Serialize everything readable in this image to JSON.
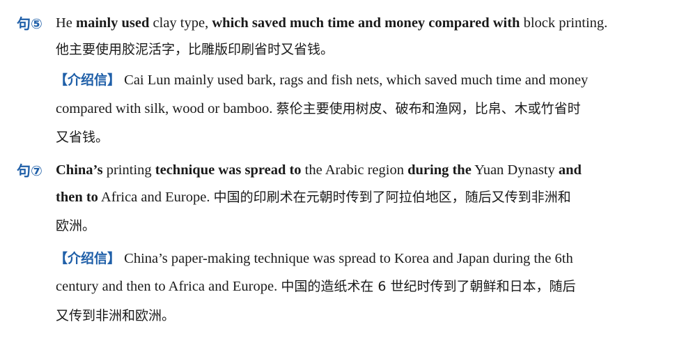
{
  "entries": [
    {
      "num": "句⑤",
      "main": {
        "line1": {
          "p1": "He ",
          "b1": "mainly used",
          "p2": " clay type, ",
          "b2": "which saved much time and money compared with",
          "p3": " block printing."
        },
        "line2_cn": "他主要使用胶泥活字，比雕版印刷省时又省钱。"
      },
      "intro": {
        "tag": "【介绍信】",
        "line1": "Cai Lun mainly used bark, rags and fish nets, which saved much time and money",
        "line2_en": "compared with silk, wood or bamboo. ",
        "line2_cn": "蔡伦主要使用树皮、破布和渔网，比帛、木或竹省时",
        "line3_cn": "又省钱。"
      }
    },
    {
      "num": "句⑦",
      "main": {
        "line1": {
          "b1": "China’s",
          "p1": " printing ",
          "b2": "technique was spread to",
          "p2": " the Arabic region ",
          "b3": "during the",
          "p3": " Yuan Dynasty ",
          "b4": "and"
        },
        "line2": {
          "b1": "then to",
          "p1": " Africa and Europe. ",
          "cn": "中国的印刷术在元朝时传到了阿拉伯地区，随后又传到非洲和"
        },
        "line3_cn": "欧洲。"
      },
      "intro": {
        "tag": "【介绍信】",
        "line1": "China’s paper-making technique was spread to Korea and Japan during the 6th",
        "line2_en": "century and then to Africa and Europe. ",
        "line2_cn": "中国的造纸术在 6 世纪时传到了朝鲜和日本，随后",
        "line3_cn": "又传到非洲和欧洲。"
      }
    }
  ]
}
